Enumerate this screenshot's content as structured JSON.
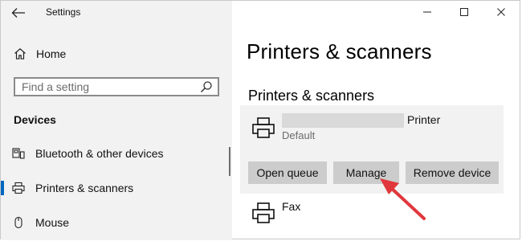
{
  "window": {
    "title": "Settings"
  },
  "sidebar": {
    "home_label": "Home",
    "search_placeholder": "Find a setting",
    "section_title": "Devices",
    "items": [
      {
        "label": "Bluetooth & other devices",
        "icon": "bluetooth-devices-icon"
      },
      {
        "label": "Printers & scanners",
        "icon": "printer-icon",
        "active": true
      },
      {
        "label": "Mouse",
        "icon": "mouse-icon"
      }
    ]
  },
  "main": {
    "page_title": "Printers & scanners",
    "section_title": "Printers & scanners",
    "printer": {
      "name_suffix": "Printer",
      "status": "Default",
      "buttons": {
        "open_queue": "Open queue",
        "manage": "Manage",
        "remove": "Remove device"
      }
    },
    "fax": {
      "label": "Fax"
    }
  },
  "colors": {
    "accent": "#0067c0",
    "annotation_arrow": "#e0373c",
    "sidebar_bg": "#f2f2f2",
    "button_bg": "#cccccc"
  }
}
